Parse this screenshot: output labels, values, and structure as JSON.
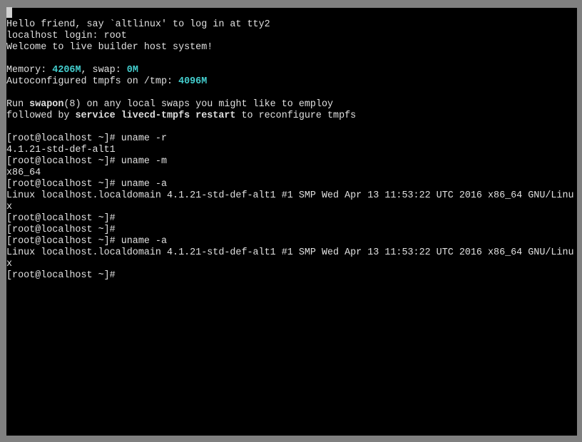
{
  "cursor_top": true,
  "lines": [
    [
      {
        "t": "Hello friend, say `altlinux' to log in at tty2"
      }
    ],
    [
      {
        "t": "localhost login: root"
      }
    ],
    [
      {
        "t": "Welcome to live builder host system!"
      }
    ],
    [],
    [
      {
        "t": "Memory: "
      },
      {
        "t": "4206M",
        "cls": "cyan bold"
      },
      {
        "t": ", swap: "
      },
      {
        "t": "0M",
        "cls": "cyan bold"
      }
    ],
    [
      {
        "t": "Autoconfigured tmpfs on /tmp: "
      },
      {
        "t": "4096M",
        "cls": "cyan bold"
      }
    ],
    [],
    [
      {
        "t": "Run "
      },
      {
        "t": "swapon",
        "cls": "bold"
      },
      {
        "t": "(8) on any local swaps you might like to employ"
      }
    ],
    [
      {
        "t": "followed by "
      },
      {
        "t": "service livecd-tmpfs restart",
        "cls": "bold"
      },
      {
        "t": " to reconfigure tmpfs"
      }
    ],
    [],
    [
      {
        "t": "[root@localhost ~]# uname -r"
      }
    ],
    [
      {
        "t": "4.1.21-std-def-alt1"
      }
    ],
    [
      {
        "t": "[root@localhost ~]# uname -m"
      }
    ],
    [
      {
        "t": "x86_64"
      }
    ],
    [
      {
        "t": "[root@localhost ~]# uname -a"
      }
    ],
    [
      {
        "t": "Linux localhost.localdomain 4.1.21-std-def-alt1 #1 SMP Wed Apr 13 11:53:22 UTC 2016 x86_64 GNU/Linux"
      }
    ],
    [
      {
        "t": "[root@localhost ~]# "
      }
    ],
    [
      {
        "t": "[root@localhost ~]# "
      }
    ],
    [
      {
        "t": "[root@localhost ~]# uname -a"
      }
    ],
    [
      {
        "t": "Linux localhost.localdomain 4.1.21-std-def-alt1 #1 SMP Wed Apr 13 11:53:22 UTC 2016 x86_64 GNU/Linux"
      }
    ],
    [
      {
        "t": "[root@localhost ~]# "
      }
    ]
  ]
}
